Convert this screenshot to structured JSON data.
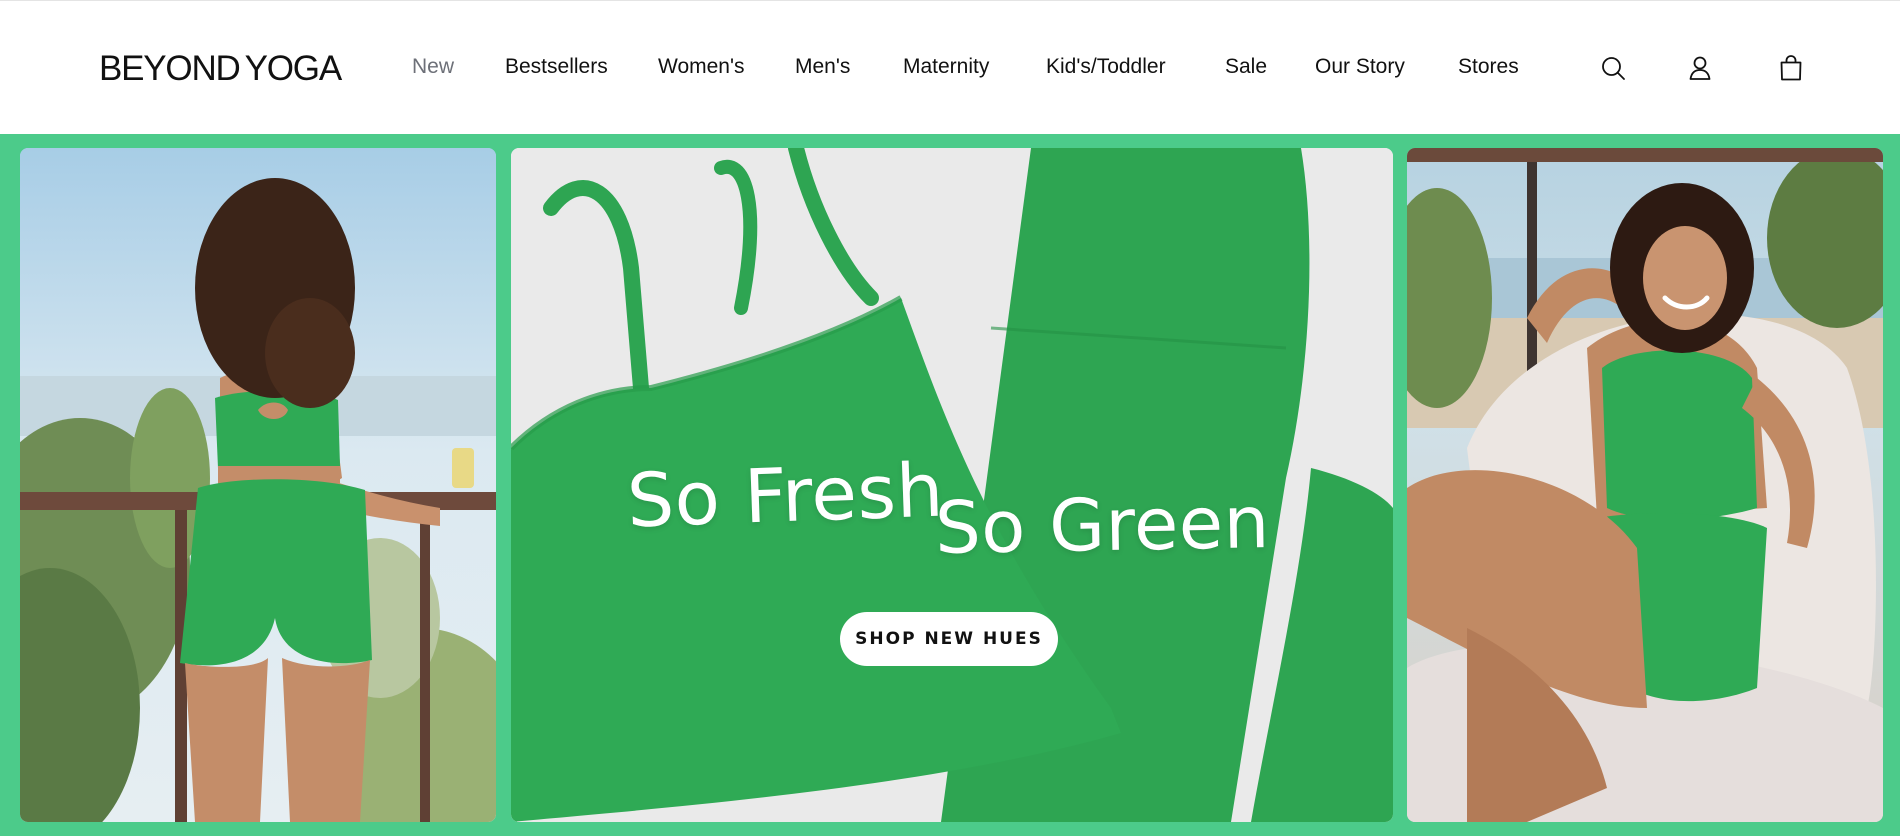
{
  "brand": {
    "name_part1": "BEYOND",
    "name_part2": "YOGA"
  },
  "nav": {
    "items": [
      {
        "label": "New",
        "active": true
      },
      {
        "label": "Bestsellers",
        "active": false
      },
      {
        "label": "Women's",
        "active": false
      },
      {
        "label": "Men's",
        "active": false
      },
      {
        "label": "Maternity",
        "active": false
      },
      {
        "label": "Kid's/Toddler",
        "active": false
      },
      {
        "label": "Sale",
        "active": false
      },
      {
        "label": "Our Story",
        "active": false
      },
      {
        "label": "Stores",
        "active": false
      }
    ]
  },
  "header_icons": [
    "search-icon",
    "account-icon",
    "shopping-bag-icon"
  ],
  "hero": {
    "headline_1": "So Fresh",
    "headline_2": "So Green",
    "cta_label": "SHOP NEW HUES"
  },
  "colors": {
    "hero_background": "#4ccb8a",
    "product_green": "#2faa55",
    "nav_active": "#6d7078",
    "cta_background": "#ffffff"
  }
}
